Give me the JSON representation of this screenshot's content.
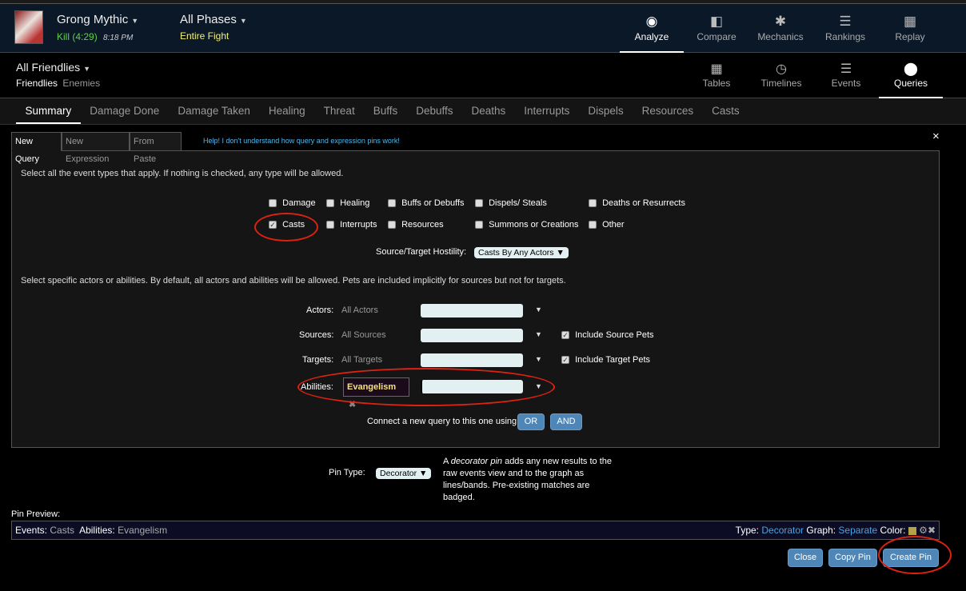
{
  "header": {
    "boss": "Grong Mythic",
    "result": "Kill (4:29)",
    "time": "8:18 PM",
    "phase": "All Phases",
    "phase_sub": "Entire Fight",
    "nav": [
      {
        "label": "Analyze",
        "icon": "eye-icon"
      },
      {
        "label": "Compare",
        "icon": "compare-icon"
      },
      {
        "label": "Mechanics",
        "icon": "puzzle-icon"
      },
      {
        "label": "Rankings",
        "icon": "sort-icon"
      },
      {
        "label": "Replay",
        "icon": "film-icon"
      }
    ]
  },
  "subheader": {
    "actors": "All Friendlies",
    "friendlies": "Friendlies",
    "enemies": "Enemies",
    "nav": [
      {
        "label": "Tables",
        "icon": "grid-icon"
      },
      {
        "label": "Timelines",
        "icon": "clock-icon"
      },
      {
        "label": "Events",
        "icon": "list-icon"
      },
      {
        "label": "Queries",
        "icon": "map-pin-icon"
      }
    ]
  },
  "tabs": [
    "Summary",
    "Damage Done",
    "Damage Taken",
    "Healing",
    "Threat",
    "Buffs",
    "Debuffs",
    "Deaths",
    "Interrupts",
    "Dispels",
    "Resources",
    "Casts"
  ],
  "query": {
    "tabs": [
      "New Query",
      "New Expression",
      "From Paste"
    ],
    "help": "Help! I don't understand how query and expression pins work!",
    "close": "×",
    "instructions": "Select all the event types that apply. If nothing is checked, any type will be allowed.",
    "event_types": [
      {
        "label": "Damage",
        "checked": false
      },
      {
        "label": "Healing",
        "checked": false
      },
      {
        "label": "Buffs or Debuffs",
        "checked": false
      },
      {
        "label": "Dispels/ Steals",
        "checked": false
      },
      {
        "label": "Deaths or Resurrects",
        "checked": false
      },
      {
        "label": "Casts",
        "checked": true
      },
      {
        "label": "Interrupts",
        "checked": false
      },
      {
        "label": "Resources",
        "checked": false
      },
      {
        "label": "Summons or Creations",
        "checked": false
      },
      {
        "label": "Other",
        "checked": false
      }
    ],
    "hostility_label": "Source/Target Hostility:",
    "hostility_value": "Casts By Any Actors ▼",
    "actors_instructions": "Select specific actors or abilities. By default, all actors and abilities will be allowed. Pets are included implicitly for sources but not for targets.",
    "actors_label": "Actors:",
    "actors_value": "All Actors",
    "sources_label": "Sources:",
    "sources_value": "All Sources",
    "include_source_pets": "Include Source Pets",
    "targets_label": "Targets:",
    "targets_value": "All Targets",
    "include_target_pets": "Include Target Pets",
    "abilities_label": "Abilities:",
    "ability_tag": "Evangelism",
    "connect": "Connect a new query to this one using",
    "or": "OR",
    "and": "AND"
  },
  "pin": {
    "type_label": "Pin Type:",
    "type_value": "Decorator ▼",
    "desc_em": "decorator pin",
    "desc_a": "A ",
    "desc_b": " adds any new results to the raw events view and to the graph as lines/bands. Pre-existing matches are badged.",
    "preview_label": "Pin Preview:",
    "events_label": "Events:",
    "events_value": "Casts",
    "abilities_label": "Abilities:",
    "abilities_value": "Evangelism",
    "type_k": "Type:",
    "type_v": "Decorator",
    "graph_k": "Graph:",
    "graph_v": "Separate",
    "color_k": "Color:",
    "color": "#b5a247"
  },
  "buttons": {
    "close": "Close",
    "copy": "Copy Pin",
    "create": "Create Pin"
  }
}
